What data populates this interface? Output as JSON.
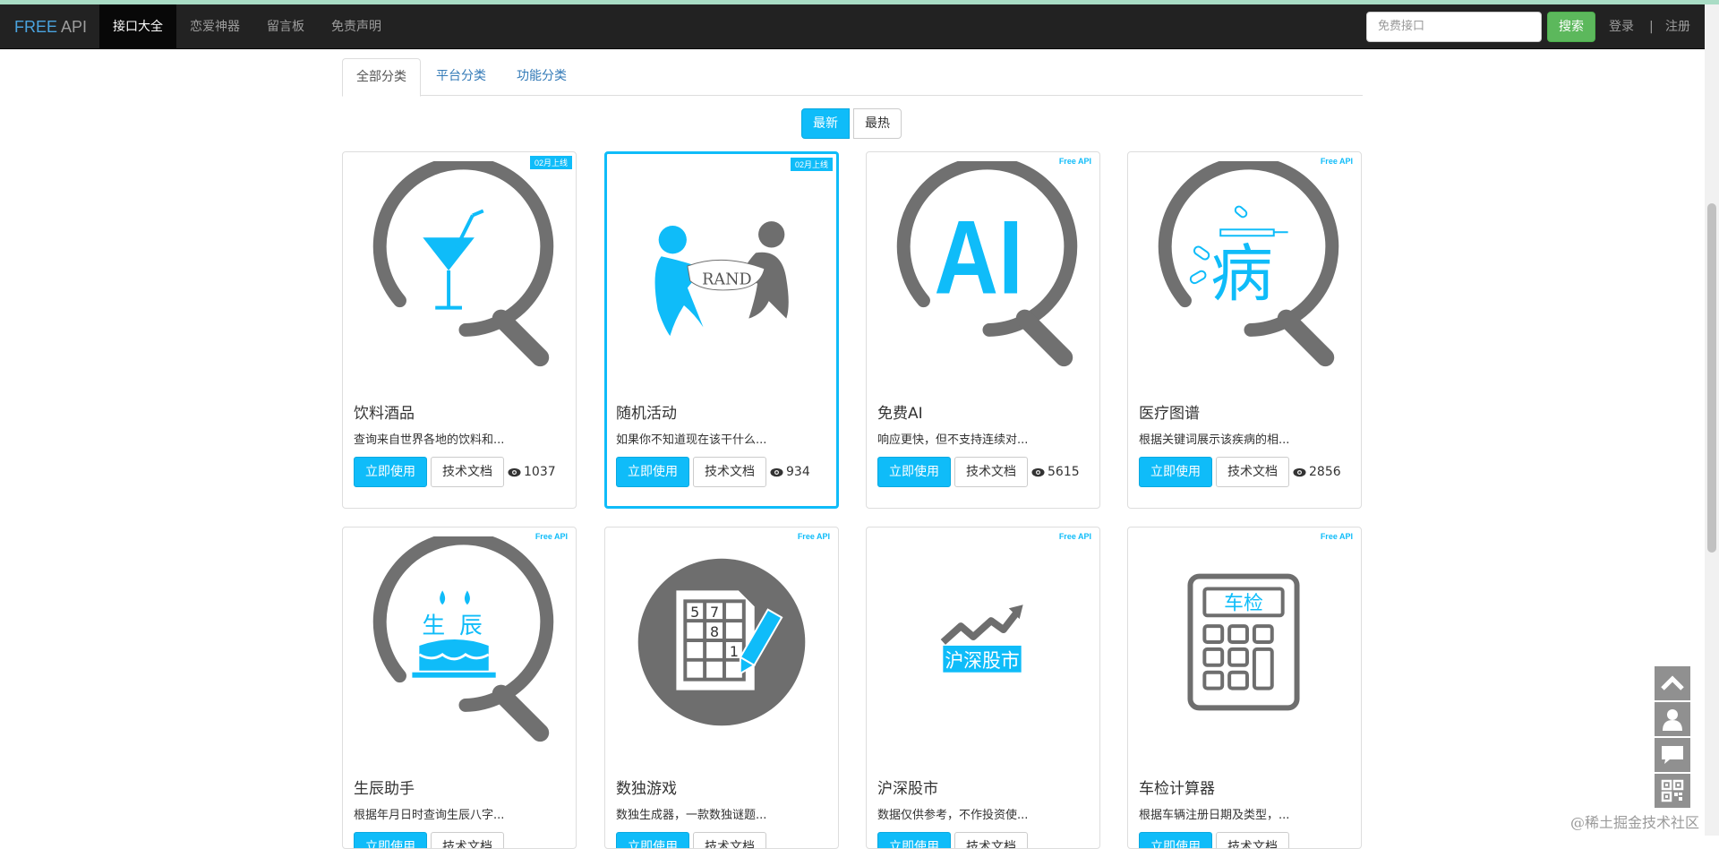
{
  "navbar": {
    "brand_free": "FREE",
    "brand_api": "API",
    "items": [
      {
        "label": "接口大全",
        "active": true
      },
      {
        "label": "恋爱神器",
        "active": false
      },
      {
        "label": "留言板",
        "active": false
      },
      {
        "label": "免责声明",
        "active": false
      }
    ],
    "search_placeholder": "免费接口",
    "search_button": "搜索",
    "login": "登录",
    "separator": "|",
    "register": "注册"
  },
  "tabs": [
    "全部分类",
    "平台分类",
    "功能分类"
  ],
  "sort": {
    "newest": "最新",
    "hottest": "最热"
  },
  "cards": [
    {
      "badge": "02月上线",
      "badge_type": "new",
      "icon": "cocktail-search-icon",
      "title": "饮料酒品",
      "desc": "查询来自世界各地的饮料和...",
      "use": "立即使用",
      "doc": "技术文档",
      "views": "1037"
    },
    {
      "badge": "02月上线",
      "badge_type": "new",
      "icon": "random-people-icon",
      "title": "随机活动",
      "desc": "如果你不知道现在该干什么...",
      "use": "立即使用",
      "doc": "技术文档",
      "views": "934"
    },
    {
      "badge": "Free API",
      "badge_type": "free",
      "icon": "ai-search-icon",
      "title": "免费AI",
      "desc": "响应更快，但不支持连续对...",
      "use": "立即使用",
      "doc": "技术文档",
      "views": "5615"
    },
    {
      "badge": "Free API",
      "badge_type": "free",
      "icon": "disease-search-icon",
      "title": "医疗图谱",
      "desc": "根据关键词展示该疾病的相...",
      "use": "立即使用",
      "doc": "技术文档",
      "views": "2856"
    },
    {
      "badge": "Free API",
      "badge_type": "free",
      "icon": "birthday-cake-search-icon",
      "title": "生辰助手",
      "desc": "根据年月日时查询生辰八字...",
      "use": "立即使用",
      "doc": "技术文档",
      "views": ""
    },
    {
      "badge": "Free API",
      "badge_type": "free",
      "icon": "sudoku-icon",
      "title": "数独游戏",
      "desc": "数独生成器，一款数独谜题...",
      "use": "立即使用",
      "doc": "技术文档",
      "views": ""
    },
    {
      "badge": "Free API",
      "badge_type": "free",
      "icon": "stock-chart-icon",
      "title": "沪深股市",
      "desc": "数据仅供参考，不作投资使...",
      "use": "立即使用",
      "doc": "技术文档",
      "views": ""
    },
    {
      "badge": "Free API",
      "badge_type": "free",
      "icon": "calculator-icon",
      "title": "车检计算器",
      "desc": "根据车辆注册日期及类型，...",
      "use": "立即使用",
      "doc": "技术文档",
      "views": ""
    }
  ],
  "icon_text": {
    "rand": "RAND",
    "ai": "AI",
    "disease": "病",
    "sheng": "生",
    "chen": "辰",
    "sudoku": [
      "5",
      "7",
      "8",
      "1"
    ],
    "stock": "沪深股市",
    "car": "车检"
  },
  "side_tools": [
    "back-to-top-icon",
    "user-icon",
    "comment-icon",
    "qrcode-icon"
  ],
  "watermark": "@稀土掘金技术社区",
  "colors": {
    "accent": "#0fbcf9",
    "navbar": "#222222",
    "search_button": "#5cb85c",
    "icon_gray": "#707070"
  }
}
